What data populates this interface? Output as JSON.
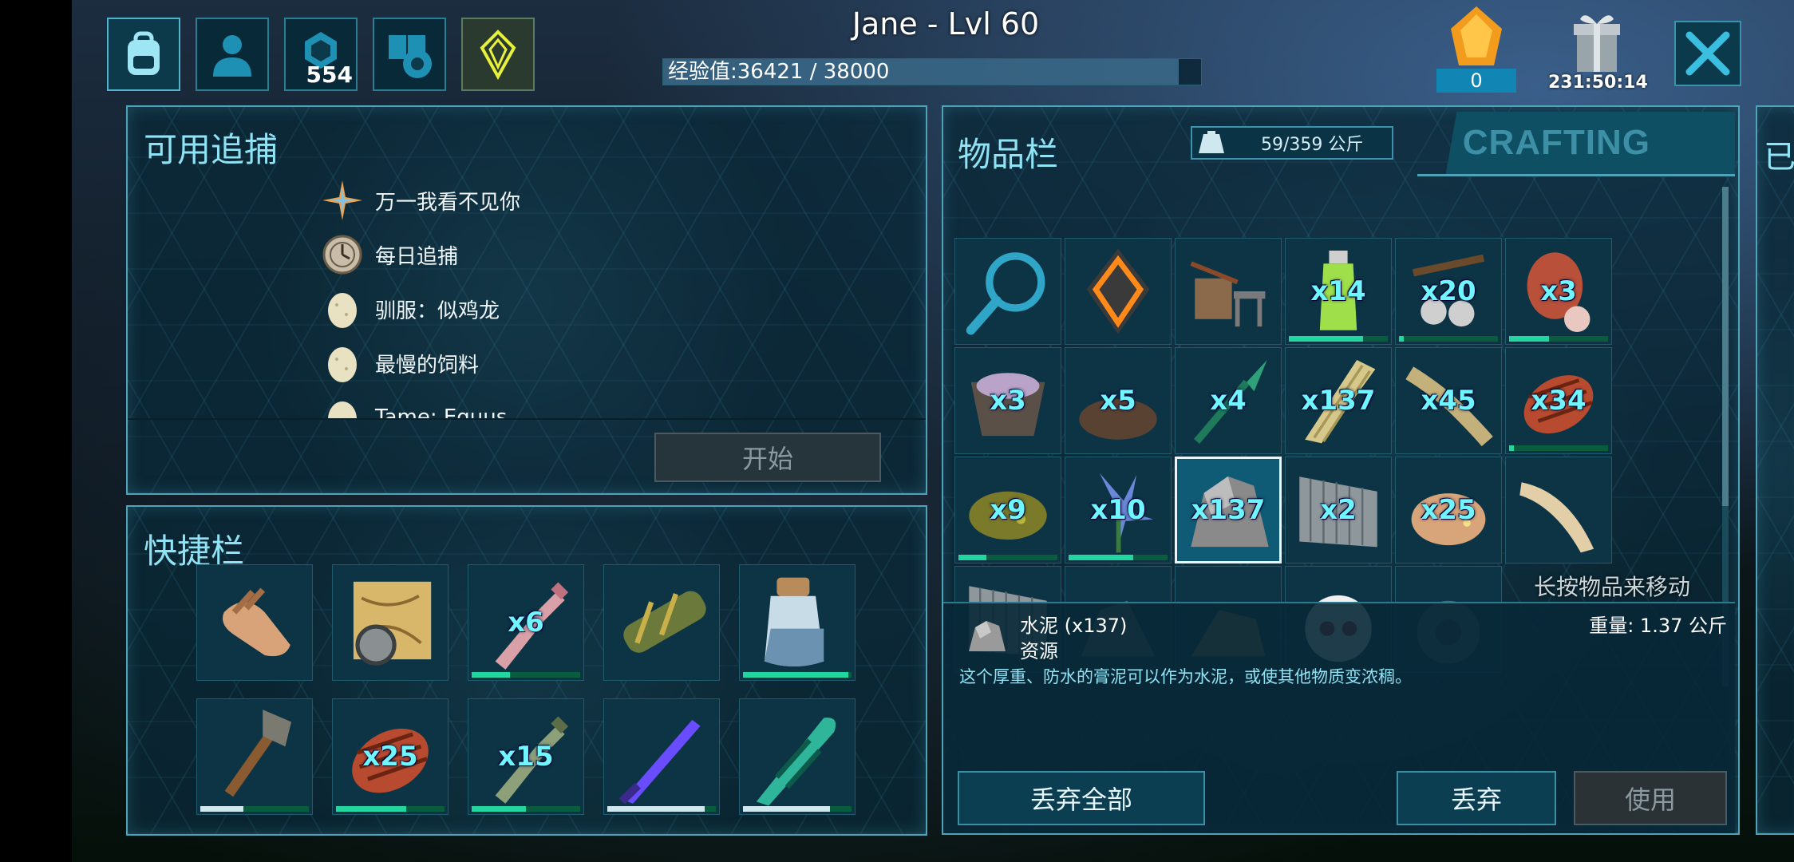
{
  "colors": {
    "accent": "#8fe3f4",
    "panel_border": "#4fa3b8",
    "qty": "#6ff6ff",
    "durability": "#22d6a0"
  },
  "header": {
    "player_title": "Jane - Lvl 60",
    "xp_label": "经验值:36421 / 38000",
    "xp_fraction": 0.958,
    "engram_points": "554",
    "element_count": "0",
    "gift_timer": "231:50:14"
  },
  "top_icons": [
    "backpack-icon",
    "character-icon",
    "engram-icon",
    "settings-icon",
    "tek-crystal-icon"
  ],
  "missions": {
    "title": "可用追捕",
    "items": [
      {
        "label": "万一我看不见你",
        "icon": "compass-star-icon"
      },
      {
        "label": "每日追捕",
        "icon": "daily-clock-icon"
      },
      {
        "label": "驯服：似鸡龙",
        "icon": "egg-icon"
      },
      {
        "label": "最慢的饲料",
        "icon": "egg-icon"
      },
      {
        "label": "Tame: Equus",
        "icon": "egg-icon"
      }
    ],
    "start_label": "开始"
  },
  "hotbar": {
    "title": "快捷栏",
    "slots": [
      {
        "icon": "hand-icon",
        "qty": "",
        "dur": null
      },
      {
        "icon": "map-compass-icon",
        "qty": "",
        "dur": null
      },
      {
        "icon": "bottle-pink-icon",
        "qty": "x6",
        "dur": 0.35
      },
      {
        "icon": "cloth-roll-icon",
        "qty": "",
        "dur": null
      },
      {
        "icon": "water-jar-icon",
        "qty": "",
        "dur": 0.97
      },
      {
        "icon": "stone-hatchet-icon",
        "qty": "",
        "dur": 0.4
      },
      {
        "icon": "cooked-meat-icon",
        "qty": "x25",
        "dur": 0.65
      },
      {
        "icon": "bottle-green-icon",
        "qty": "x15",
        "dur": 0.5
      },
      {
        "icon": "purple-sword-icon",
        "qty": "",
        "dur": 0.9
      },
      {
        "icon": "green-blade-icon",
        "qty": "",
        "dur": 0.8
      }
    ]
  },
  "inventory": {
    "title": "物品栏",
    "weight_label": "59/359 公斤",
    "crafting_tab": "CRAFTING",
    "hint": "长按物品来移动",
    "slots": [
      {
        "icon": "magnifier-icon",
        "qty": "",
        "dur": null
      },
      {
        "icon": "tek-implant-icon",
        "qty": "",
        "dur": null
      },
      {
        "icon": "smithy-icon",
        "qty": "",
        "dur": null
      },
      {
        "icon": "stimulant-bottle-icon",
        "qty": "x14",
        "dur": 0.75
      },
      {
        "icon": "slingshot-icon",
        "qty": "x20",
        "dur": 0.05
      },
      {
        "icon": "raw-meat-icon",
        "qty": "x3",
        "dur": 0.4
      },
      {
        "icon": "mortar-icon",
        "qty": "x3",
        "dur": null
      },
      {
        "icon": "dirt-icon",
        "qty": "x5",
        "dur": null
      },
      {
        "icon": "spear-icon",
        "qty": "x4",
        "dur": null
      },
      {
        "icon": "thatch-icon",
        "qty": "x137",
        "dur": null
      },
      {
        "icon": "fiber-icon",
        "qty": "x45",
        "dur": null
      },
      {
        "icon": "cooked-meat-icon",
        "qty": "x34",
        "dur": 0.05
      },
      {
        "icon": "spoiled-food-icon",
        "qty": "x9",
        "dur": 0.28
      },
      {
        "icon": "blue-flower-icon",
        "qty": "x10",
        "dur": 0.65
      },
      {
        "icon": "cementing-paste-icon",
        "qty": "x137",
        "dur": null,
        "selected": true
      },
      {
        "icon": "metal-wall-icon",
        "qty": "x2",
        "dur": null
      },
      {
        "icon": "sparkpowder-icon",
        "qty": "x25",
        "dur": null
      },
      {
        "icon": "horn-icon",
        "qty": "",
        "dur": null
      }
    ],
    "partial_row": [
      "metal-wall-icon",
      "rock-icon",
      "hide-icon",
      "skull-icon",
      "gear-icon"
    ]
  },
  "detail": {
    "name": "水泥 (x137)",
    "category": "资源",
    "weight": "重量: 1.37 公斤",
    "description": "这个厚重、防水的膏泥可以作为水泥，或使其他物质变浓稠。",
    "drop_all_label": "丢弃全部",
    "drop_label": "丢弃",
    "use_label": "使用"
  }
}
